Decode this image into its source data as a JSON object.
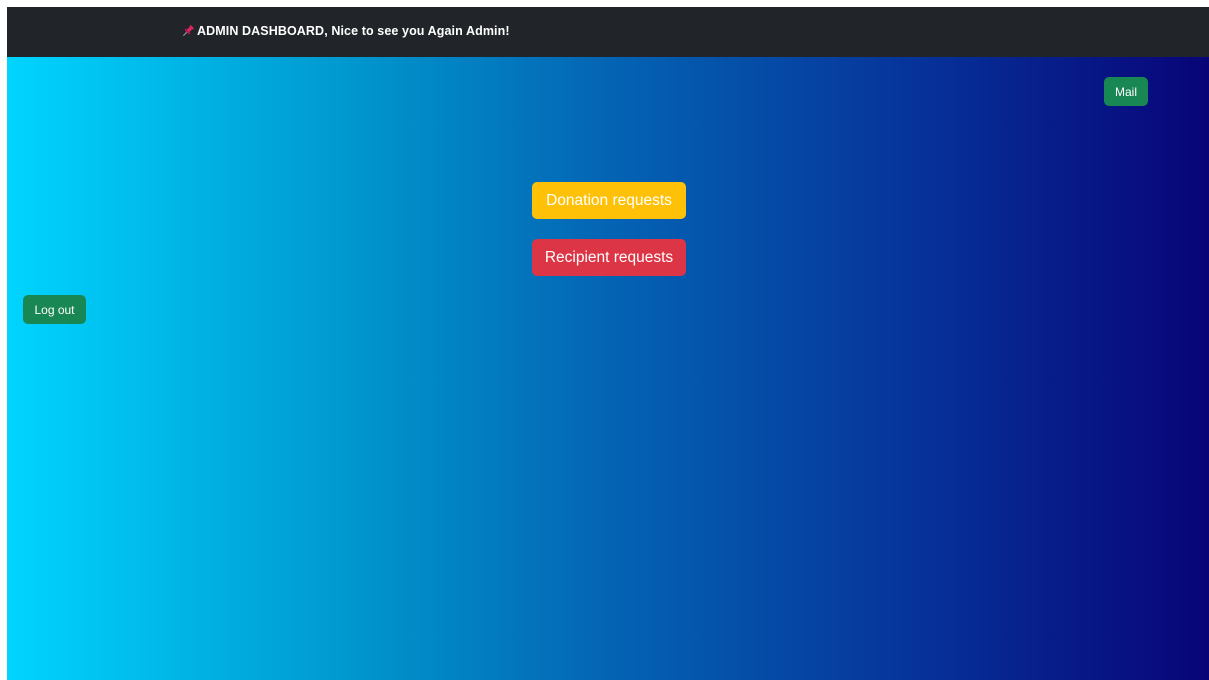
{
  "navbar": {
    "title": "ADMIN DASHBOARD, Nice to see you Again Admin!",
    "icon": "pushpin-icon"
  },
  "actions": {
    "mail_label": "Mail",
    "donation_label": "Donation requests",
    "recipient_label": "Recipient requests",
    "logout_label": "Log out"
  },
  "colors": {
    "navbar_bg": "#212529",
    "gradient_start": "#00d4ff",
    "gradient_end": "#080478",
    "success": "#198754",
    "warning": "#ffc107",
    "danger": "#dc3545"
  }
}
